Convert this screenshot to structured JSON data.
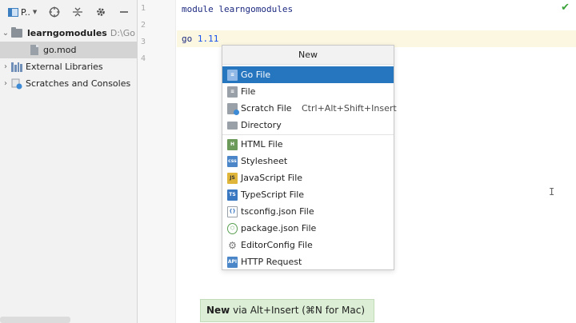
{
  "project_toolbar": {
    "view_selector": "P..",
    "icons": [
      "target-icon",
      "collapse-icon",
      "gear-icon",
      "minimize-icon"
    ]
  },
  "tree": {
    "root": {
      "name": "learngomodules",
      "path": "D:\\Go"
    },
    "file": {
      "name": "go.mod"
    },
    "external_libraries": "External Libraries",
    "scratches": "Scratches and Consoles"
  },
  "editor": {
    "line_numbers": [
      "1",
      "2",
      "3",
      "4"
    ],
    "line1_keyword": "module ",
    "line1_value": "learngomodules",
    "line3_keyword": "go ",
    "line3_value": "1.11"
  },
  "popup": {
    "title": "New",
    "items": [
      {
        "label": "Go File",
        "icon": "go-file-icon",
        "shortcut": ""
      },
      {
        "label": "File",
        "icon": "file-icon",
        "shortcut": ""
      },
      {
        "label": "Scratch File",
        "icon": "scratch-file-icon",
        "shortcut": "Ctrl+Alt+Shift+Insert"
      },
      {
        "label": "Directory",
        "icon": "directory-icon",
        "shortcut": ""
      },
      {
        "label": "HTML File",
        "icon": "html-file-icon",
        "shortcut": ""
      },
      {
        "label": "Stylesheet",
        "icon": "stylesheet-icon",
        "shortcut": ""
      },
      {
        "label": "JavaScript File",
        "icon": "javascript-file-icon",
        "shortcut": ""
      },
      {
        "label": "TypeScript File",
        "icon": "typescript-file-icon",
        "shortcut": ""
      },
      {
        "label": "tsconfig.json File",
        "icon": "tsconfig-file-icon",
        "shortcut": ""
      },
      {
        "label": "package.json File",
        "icon": "package-json-file-icon",
        "shortcut": ""
      },
      {
        "label": "EditorConfig File",
        "icon": "editorconfig-file-icon",
        "shortcut": ""
      },
      {
        "label": "HTTP Request",
        "icon": "http-request-icon",
        "shortcut": ""
      }
    ]
  },
  "hint": {
    "bold": "New",
    "rest": " via Alt+Insert (⌘N for Mac)"
  },
  "colors": {
    "selection": "#2675bf",
    "hint_bg": "#dcefd6",
    "current_line": "#fbf7e0"
  }
}
